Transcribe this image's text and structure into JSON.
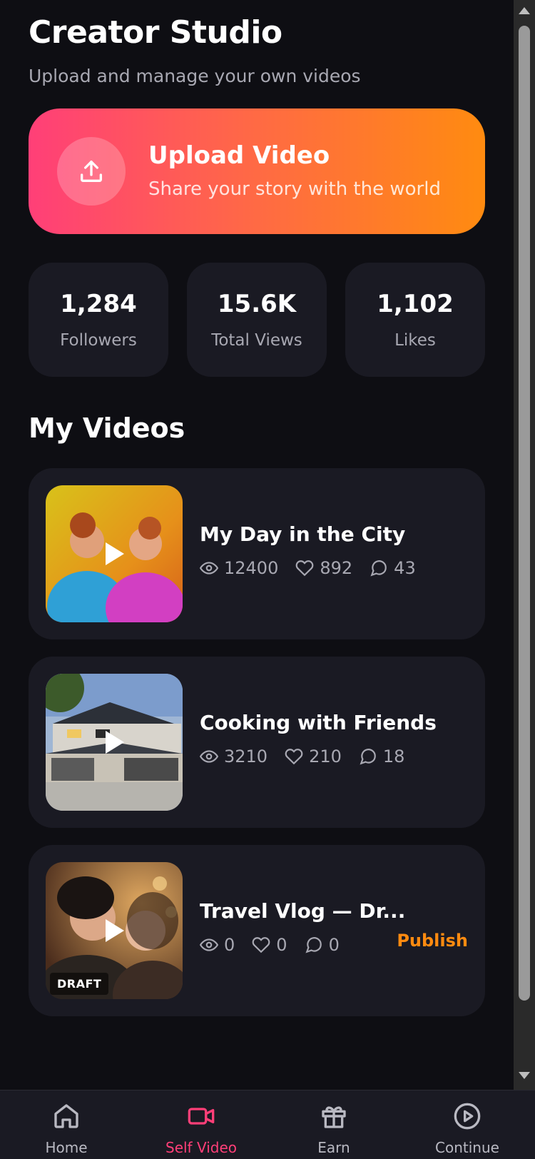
{
  "header": {
    "title": "Creator Studio",
    "subtitle": "Upload and manage your own videos"
  },
  "upload": {
    "title": "Upload Video",
    "subtitle": "Share your story with the world",
    "icon": "upload-icon"
  },
  "stats": [
    {
      "value": "1,284",
      "label": "Followers"
    },
    {
      "value": "15.6K",
      "label": "Total Views"
    },
    {
      "value": "1,102",
      "label": "Likes"
    }
  ],
  "section_title": "My Videos",
  "videos": [
    {
      "title": "My Day in the City",
      "views": "12400",
      "likes": "892",
      "comments": "43",
      "thumbnail": "two-friends-laughing"
    },
    {
      "title": "Cooking with Friends",
      "views": "3210",
      "likes": "210",
      "comments": "18",
      "thumbnail": "modern-house"
    },
    {
      "title": "Travel Vlog — Dr...",
      "views": "0",
      "likes": "0",
      "comments": "0",
      "thumbnail": "couple-portrait",
      "badge": "DRAFT",
      "action": "Publish"
    }
  ],
  "nav": [
    {
      "label": "Home",
      "icon": "home-icon",
      "active": false
    },
    {
      "label": "Self Video",
      "icon": "video-camera-icon",
      "active": true
    },
    {
      "label": "Earn",
      "icon": "gift-icon",
      "active": false
    },
    {
      "label": "Continue",
      "icon": "play-circle-icon",
      "active": false
    }
  ],
  "colors": {
    "background": "#0e0e13",
    "card": "#1a1a23",
    "accent_pink": "#ff3f78",
    "accent_orange": "#ff8b10",
    "muted_text": "#a8a8b2"
  }
}
